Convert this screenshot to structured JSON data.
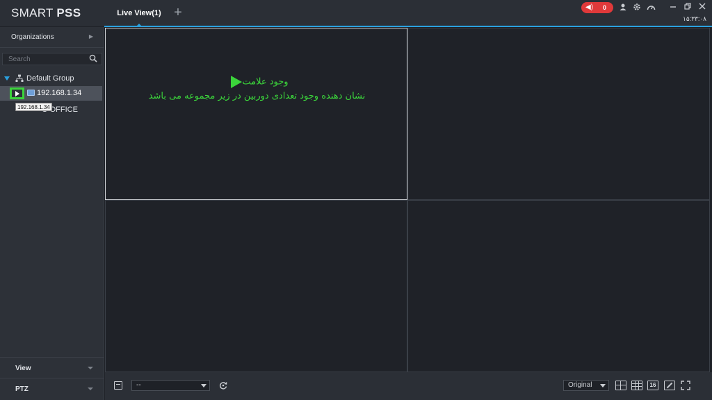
{
  "app": {
    "title_light": "SMART ",
    "title_bold": "PSS"
  },
  "tabs": [
    {
      "label": "Live View(1)"
    }
  ],
  "add_tab": "+",
  "titlebar": {
    "alarm_count": "0",
    "clock": "۱۵:۳۳:۰۸"
  },
  "sidebar": {
    "organizations_label": "Organizations",
    "search_placeholder": "Search",
    "group_label": "Default Group",
    "device_label": "192.168.1.34",
    "office_label": "O OFFICE",
    "tooltip": "192.168.1.34",
    "view_label": "View",
    "ptz_label": "PTZ"
  },
  "annotation": {
    "line1": "وجود علامت",
    "line2": "نشان دهنده وجود تعدادی دوربین در  زیر مجموعه  می باشد"
  },
  "bottombar": {
    "select_value": "--",
    "aspect_value": "Original",
    "split16_label": "16"
  },
  "colors": {
    "accent": "#2aa1e0",
    "highlight": "#3bd43b",
    "alarm": "#e0393a"
  }
}
